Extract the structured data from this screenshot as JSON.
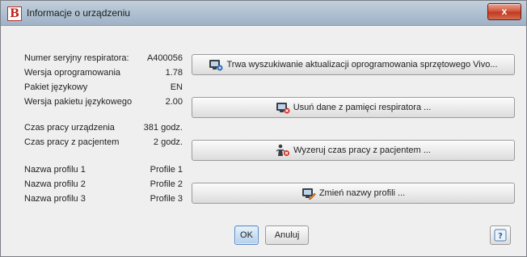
{
  "window": {
    "title": "Informacje o urządzeniu",
    "close_label": "x",
    "app_icon_letter": "B",
    "brand_color": "#c4211a"
  },
  "info": {
    "serial_label": "Numer seryjny respiratora:",
    "serial_value": "A400056",
    "firmware_label": "Wersja oprogramowania",
    "firmware_value": "1.78",
    "language_pack_label": "Pakiet językowy",
    "language_pack_value": "EN",
    "language_pack_version_label": "Wersja pakietu językowego",
    "language_pack_version_value": "2.00",
    "device_hours_label": "Czas pracy urządzenia",
    "device_hours_value": "381 godz.",
    "patient_hours_label": "Czas pracy z pacjentem",
    "patient_hours_value": "2 godz.",
    "profile1_label": "Nazwa profilu 1",
    "profile1_value": "Profile 1",
    "profile2_label": "Nazwa profilu 2",
    "profile2_value": "Profile 2",
    "profile3_label": "Nazwa profilu 3",
    "profile3_value": "Profile 3"
  },
  "actions": {
    "firmware_update": "Trwa wyszukiwanie aktualizacji oprogramowania sprzętowego Vivo...",
    "delete_data": "Usuń dane z pamięci respiratora ...",
    "reset_patient_time": "Wyzeruj czas pracy z pacjentem ...",
    "rename_profiles": "Zmień nazwy profili ..."
  },
  "icons": {
    "firmware_update": "device-update-icon",
    "delete_data": "device-delete-icon",
    "reset_patient_time": "patient-reset-icon",
    "rename_profiles": "device-edit-icon",
    "help": "help-icon"
  },
  "footer": {
    "ok_label": "OK",
    "cancel_label": "Anuluj",
    "help_label": "?"
  }
}
